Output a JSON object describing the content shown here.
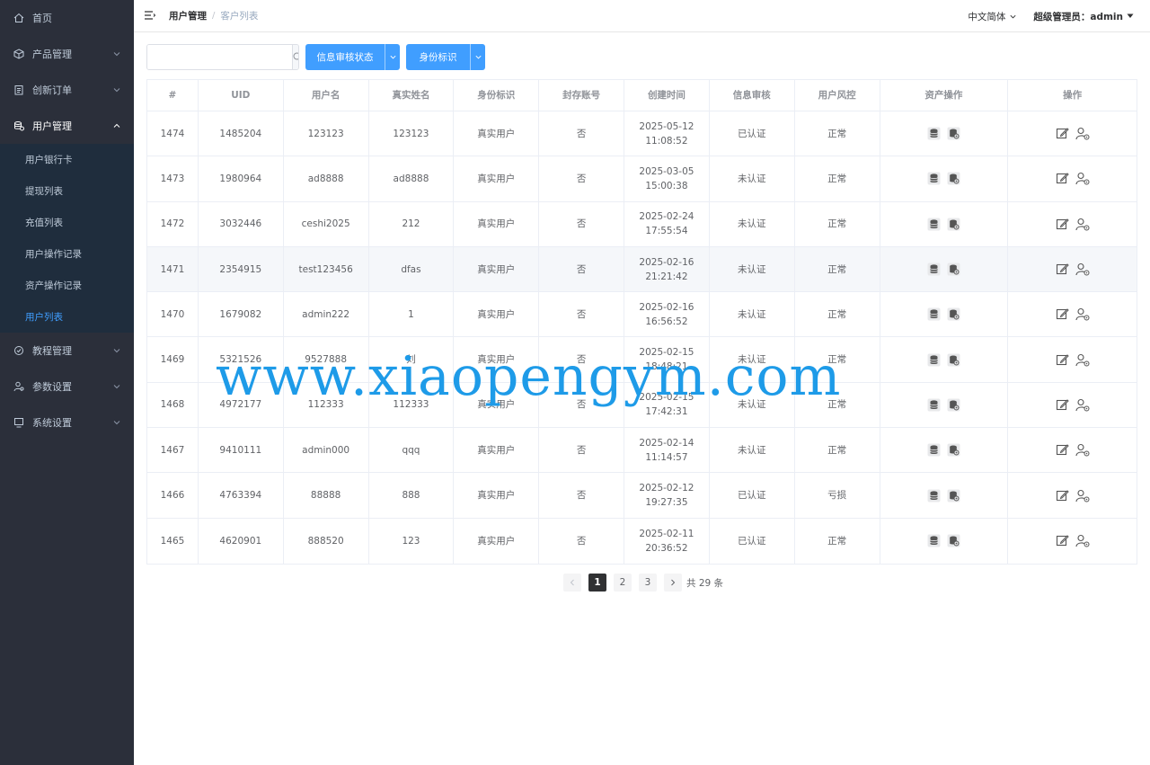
{
  "sidebar": {
    "items": [
      {
        "label": "首页",
        "icon": "home-icon"
      },
      {
        "label": "产品管理",
        "icon": "box-icon"
      },
      {
        "label": "创新订单",
        "icon": "clipboard-icon"
      },
      {
        "label": "用户管理",
        "icon": "database-icon"
      },
      {
        "label": "教程管理",
        "icon": "check-circle-icon"
      },
      {
        "label": "参数设置",
        "icon": "user-settings-icon"
      },
      {
        "label": "系统设置",
        "icon": "monitor-icon"
      }
    ],
    "submenu": [
      "用户银行卡",
      "提现列表",
      "充值列表",
      "用户操作记录",
      "资产操作记录",
      "用户列表"
    ]
  },
  "header": {
    "breadcrumb_parent": "用户管理",
    "breadcrumb_sep": "/",
    "breadcrumb_current": "客户列表",
    "language": "中文简体",
    "admin_label": "超级管理员：admin"
  },
  "filter": {
    "search_value": "",
    "status_button": "信息审核状态",
    "identity_button": "身份标识"
  },
  "table": {
    "headers": [
      "#",
      "UID",
      "用户名",
      "真实姓名",
      "身份标识",
      "封存账号",
      "创建时间",
      "信息审核",
      "用户风控",
      "资产操作",
      "操作"
    ],
    "rows": [
      [
        "1474",
        "1485204",
        "123123",
        "123123",
        "真实用户",
        "否",
        "2025-05-12 11:08:52",
        "已认证",
        "正常"
      ],
      [
        "1473",
        "1980964",
        "ad8888",
        "ad8888",
        "真实用户",
        "否",
        "2025-03-05 15:00:38",
        "未认证",
        "正常"
      ],
      [
        "1472",
        "3032446",
        "ceshi2025",
        "212",
        "真实用户",
        "否",
        "2025-02-24 17:55:54",
        "未认证",
        "正常"
      ],
      [
        "1471",
        "2354915",
        "test123456",
        "dfas",
        "真实用户",
        "否",
        "2025-02-16 21:21:42",
        "未认证",
        "正常"
      ],
      [
        "1470",
        "1679082",
        "admin222",
        "1",
        "真实用户",
        "否",
        "2025-02-16 16:56:52",
        "未认证",
        "正常"
      ],
      [
        "1469",
        "5321526",
        "9527888",
        "刘",
        "真实用户",
        "否",
        "2025-02-15 18:48:21",
        "未认证",
        "正常"
      ],
      [
        "1468",
        "4972177",
        "112333",
        "112333",
        "真实用户",
        "否",
        "2025-02-15 17:42:31",
        "未认证",
        "正常"
      ],
      [
        "1467",
        "9410111",
        "admin000",
        "qqq",
        "真实用户",
        "否",
        "2025-02-14 11:14:57",
        "未认证",
        "正常"
      ],
      [
        "1466",
        "4763394",
        "88888",
        "888",
        "真实用户",
        "否",
        "2025-02-12 19:27:35",
        "已认证",
        "亏损"
      ],
      [
        "1465",
        "4620901",
        "888520",
        "123",
        "真实用户",
        "否",
        "2025-02-11 20:36:52",
        "已认证",
        "正常"
      ]
    ]
  },
  "pagination": {
    "pages": [
      "1",
      "2",
      "3"
    ],
    "current": "1",
    "total_text": "共 29 条"
  },
  "watermark": "www.xiaopengym.com",
  "colors": {
    "accent": "#409eff",
    "sidebar_bg": "#2b2f3a",
    "watermark": "#1e9be8"
  }
}
